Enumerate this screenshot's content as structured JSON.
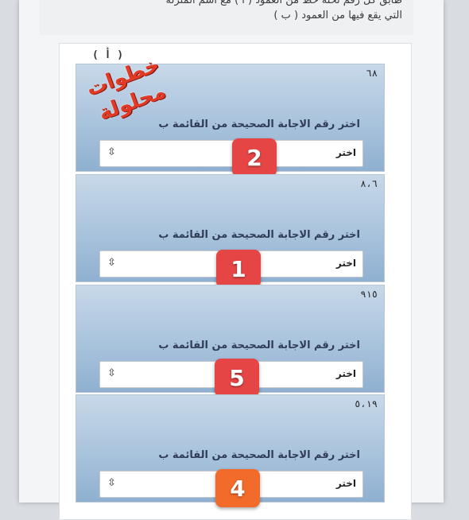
{
  "instructions": {
    "line1": "طابق كل رقم تحته خط من العمود ( أ ) مع اسم المنزلة",
    "line2": "التي يقع فيها من العمود ( ب )"
  },
  "column_label": "( أ )",
  "stamp": {
    "line1": "خطوات",
    "line2": "محلولة"
  },
  "questions": [
    {
      "number": "٦٨",
      "prompt": "اختر رقم الاجابة الصحيحة من القائمة ب",
      "select_value": "اختر",
      "badge": "2"
    },
    {
      "number": "٨،٦",
      "prompt": "اختر رقم الاجابة الصحيحة من القائمة ب",
      "select_value": "اختر",
      "badge": "1"
    },
    {
      "number": "٩١٥",
      "prompt": "اختر رقم الاجابة الصحيحة من القائمة ب",
      "select_value": "اختر",
      "badge": "5"
    },
    {
      "number": "٥،١٩",
      "prompt": "اختر رقم الاجابة الصحيحة من القائمة ب",
      "select_value": "اختر",
      "badge": "4"
    }
  ],
  "colors": {
    "badge_red": "#e64545",
    "badge_orange": "#f26b2a",
    "stamp": "#e23a26"
  },
  "icons": {
    "select_arrow": "updown-chevron-icon"
  }
}
